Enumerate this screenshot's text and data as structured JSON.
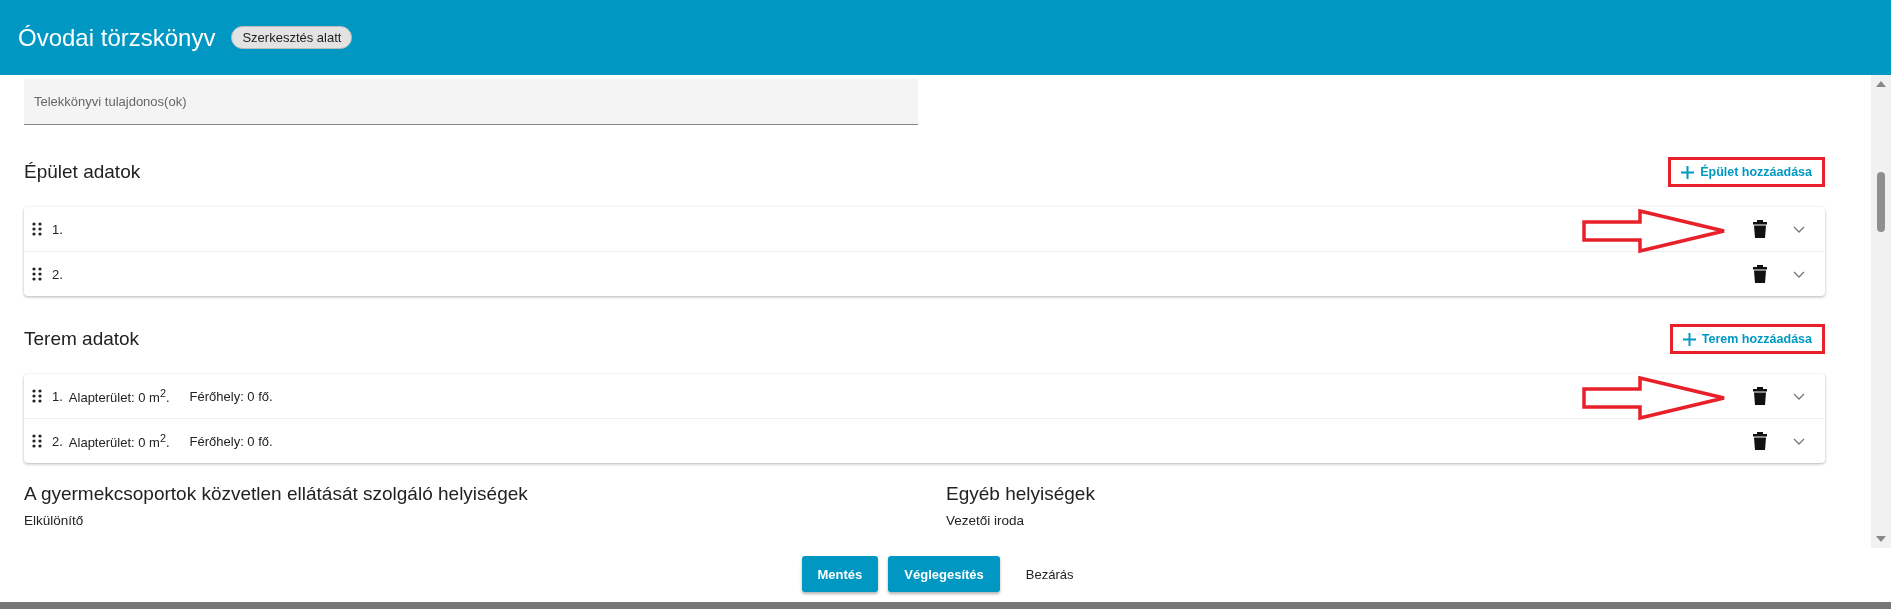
{
  "window": {
    "title": "Óvodai törzskönyv",
    "status_badge": "Szerkesztés alatt"
  },
  "owner_field": {
    "placeholder": "Telekkönyvi tulajdonos(ok)"
  },
  "sections": [
    {
      "kind": "building",
      "title": "Épület adatok",
      "add_button": {
        "label": "Épület hozzáadása",
        "highlighted": true
      },
      "items": [
        {
          "number": "1.",
          "pointed": true
        },
        {
          "number": "2.",
          "pointed": false
        }
      ]
    },
    {
      "kind": "room",
      "title": "Terem adatok",
      "add_button": {
        "label": "Terem hozzáadása",
        "highlighted": true
      },
      "items": [
        {
          "number": "1.",
          "area": "Alapterület: 0 m$^{2}$.",
          "capacity": "Férőhely: 0 fő.",
          "pointed": true
        },
        {
          "number": "2.",
          "area": "Alapterület: 0 m$^{2}$.",
          "capacity": "Férőhely: 0 fő.",
          "pointed": false
        }
      ]
    }
  ],
  "room_groups": [
    {
      "title": "A gyermekcsoportok közvetlen ellátását szolgáló helyiségek",
      "items": [
        "Elkülönítő"
      ]
    },
    {
      "title": "Egyéb helyiségek",
      "items": [
        "Vezetői iroda"
      ]
    }
  ],
  "footer_buttons": [
    {
      "label": "Mentés",
      "kind": "primary"
    },
    {
      "label": "Véglegesítés",
      "kind": "primary"
    },
    {
      "label": "Bezárás",
      "kind": "text"
    }
  ]
}
